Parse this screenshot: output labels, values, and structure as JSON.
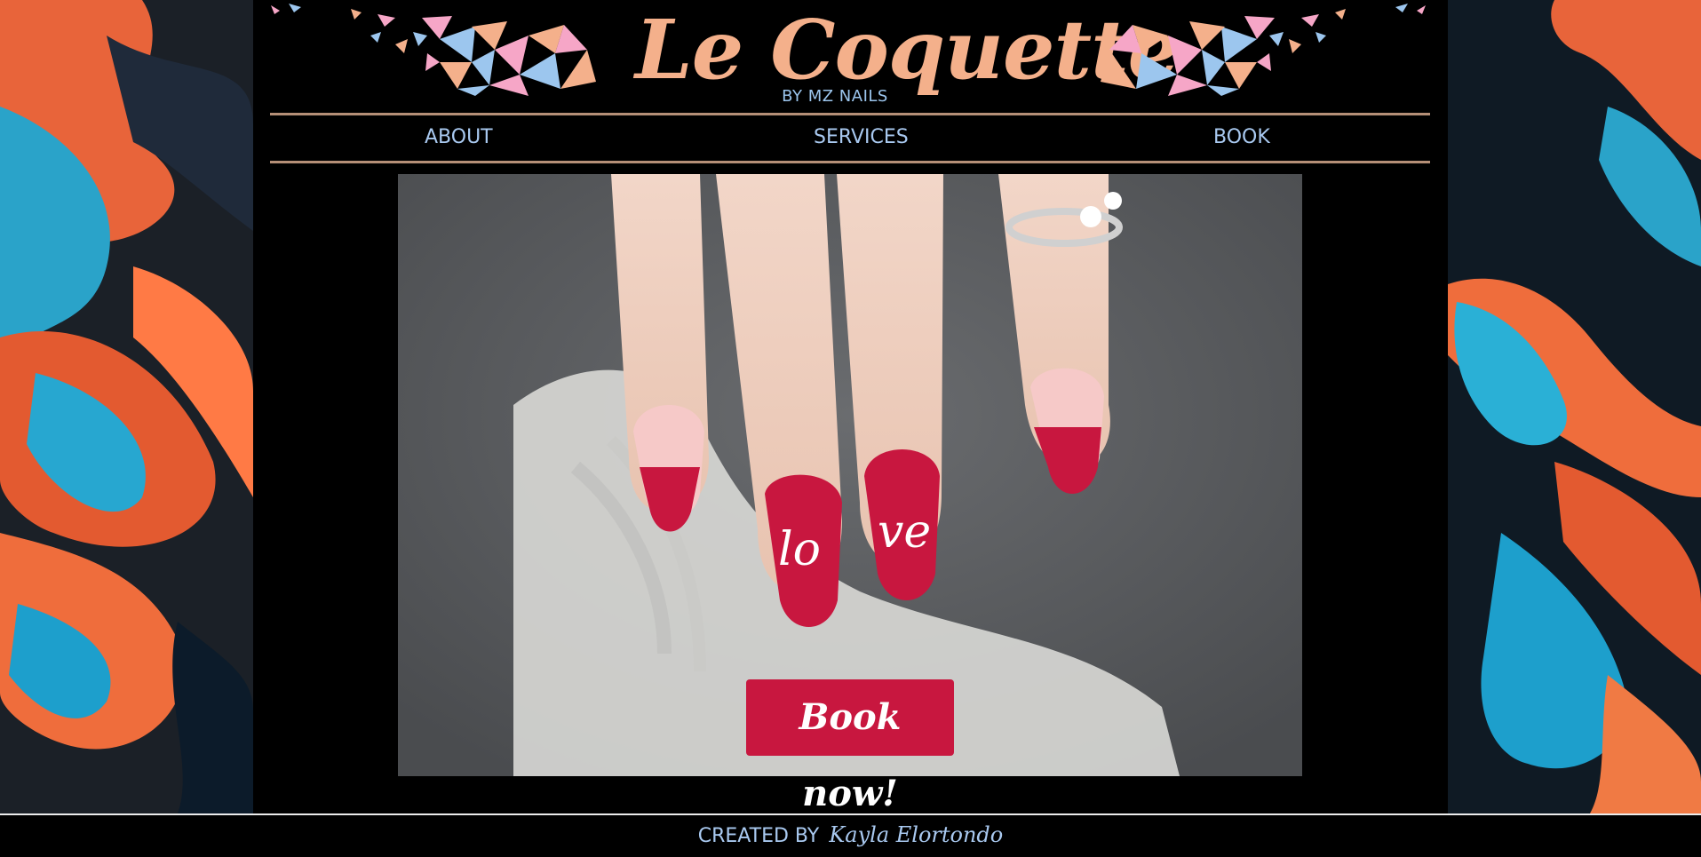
{
  "brand": {
    "title": "Le Coquette",
    "subtitle": "BY MZ NAILS"
  },
  "nav": {
    "about": "ABOUT",
    "services": "SERVICES",
    "book": "BOOK"
  },
  "hero": {
    "cta_label": "Book now!"
  },
  "footer": {
    "created_by": "CREATED BY",
    "author": "Kayla Elortondo"
  },
  "colors": {
    "background": "#000000",
    "logo": "#f4b08b",
    "nav_text": "#a9c9f0",
    "divider": "#b58f77",
    "cta": "#c8173f"
  },
  "icons": [
    "geometric-gems-left",
    "geometric-gems-right"
  ]
}
